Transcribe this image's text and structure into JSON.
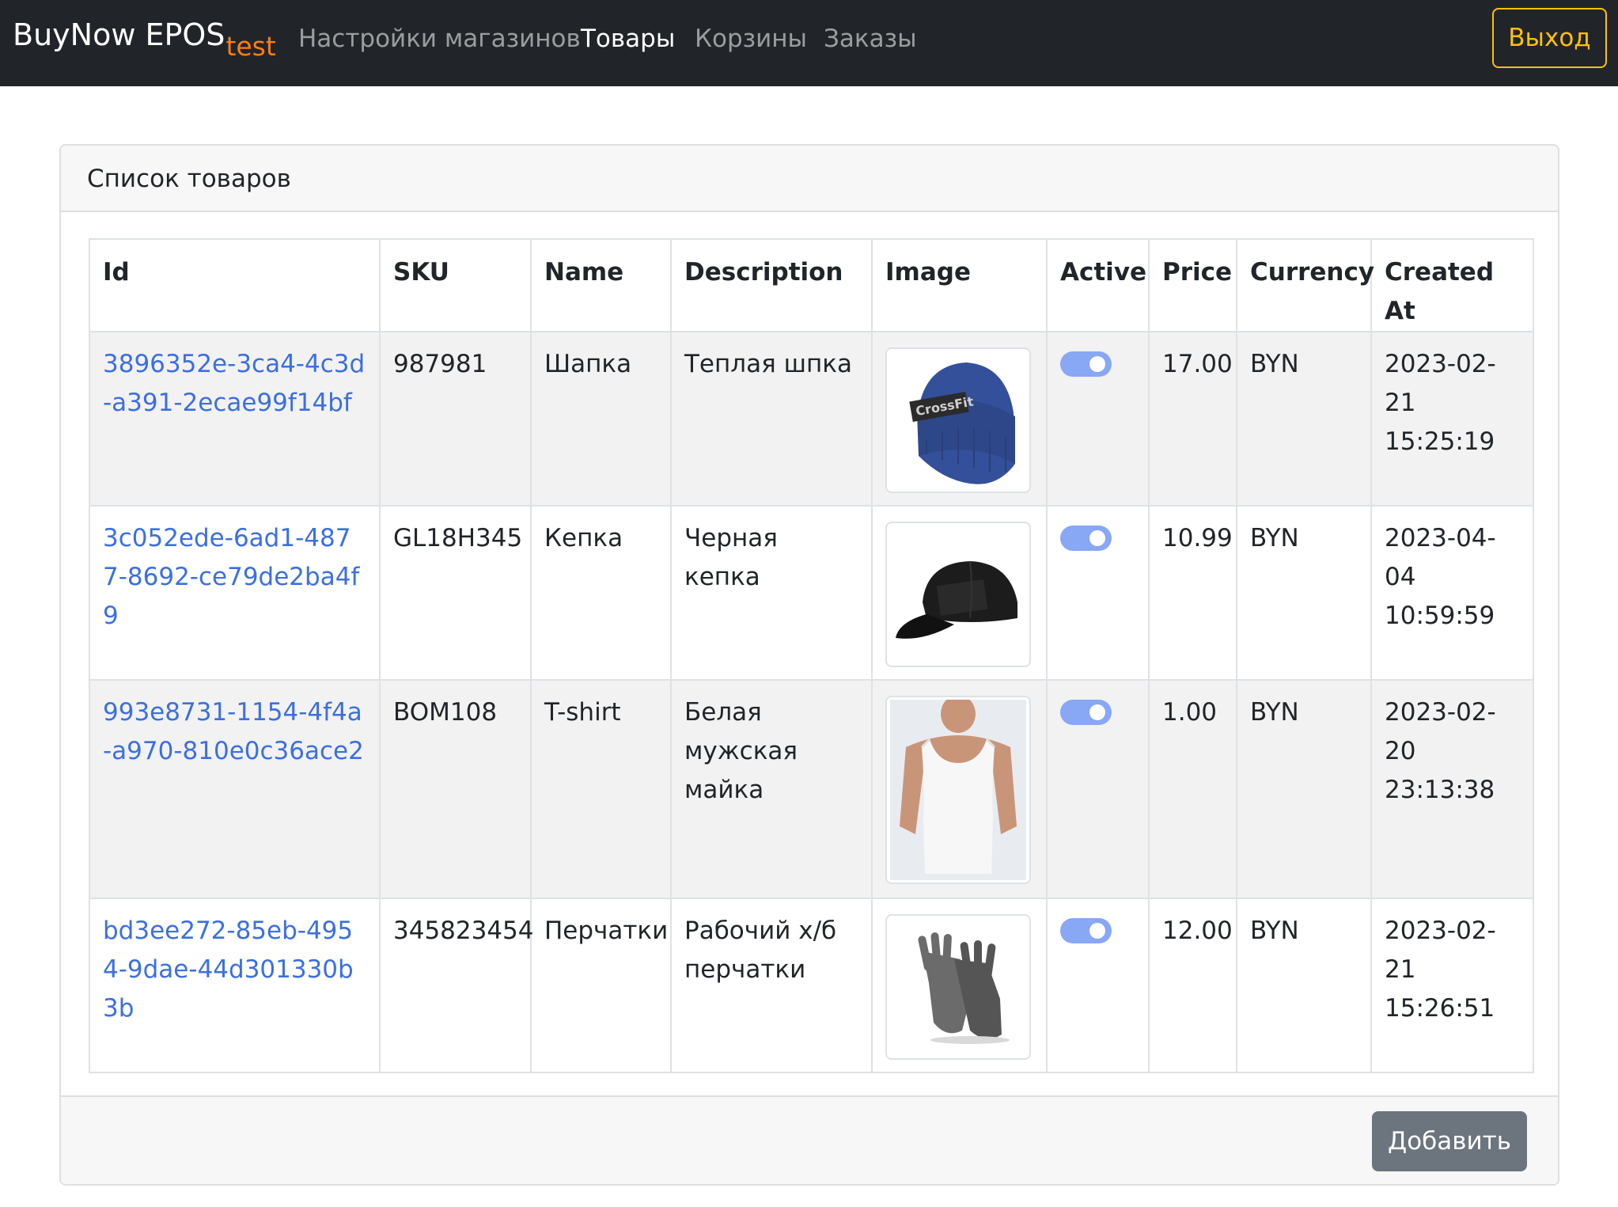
{
  "navbar": {
    "brand": "BuyNow EPOS",
    "brand_sub": "test",
    "links": [
      "Настройки магазинов",
      "Товары",
      "Корзины",
      "Заказы"
    ],
    "active_link": "Товары",
    "logout_label": "Выход"
  },
  "card": {
    "title": "Список товаров",
    "add_label": "Добавить"
  },
  "table": {
    "headers": [
      "Id",
      "SKU",
      "Name",
      "Description",
      "Image",
      "Active",
      "Price",
      "Currency",
      "Created At"
    ],
    "rows": [
      {
        "id": "3896352e-3ca4-4c3d-a391-2ecae99f14bf",
        "sku": "987981",
        "name": "Шапка",
        "description": "Теплая шпка",
        "image": "blue-beanie-image",
        "active": true,
        "price": "17.00",
        "currency": "BYN",
        "created_at": "2023-02-21 15:25:19"
      },
      {
        "id": "3c052ede-6ad1-4877-8692-ce79de2ba4f9",
        "sku": "GL18H345",
        "name": "Кепка",
        "description": "Черная кепка",
        "image": "black-cap-image",
        "active": true,
        "price": "10.99",
        "currency": "BYN",
        "created_at": "2023-04-04 10:59:59"
      },
      {
        "id": "993e8731-1154-4f4a-a970-810e0c36ace2",
        "sku": "BOM108",
        "name": "T-shirt",
        "description": "Белая мужская майка",
        "image": "white-tank-top-image",
        "active": true,
        "price": "1.00",
        "currency": "BYN",
        "created_at": "2023-02-20 23:13:38"
      },
      {
        "id": "bd3ee272-85eb-4954-9dae-44d301330b3b",
        "sku": "345823454",
        "name": "Перчатки",
        "description": "Рабочий х/б перчатки",
        "image": "work-gloves-image",
        "active": true,
        "price": "12.00",
        "currency": "BYN",
        "created_at": "2023-02-21 15:26:51"
      }
    ]
  },
  "colors": {
    "navbar_bg": "#212529",
    "brand_sub": "#fd7e14",
    "logout": "#ffc107",
    "link": "#3c6fe0",
    "toggle": "#88a7f5",
    "add_button": "#6c757d"
  }
}
